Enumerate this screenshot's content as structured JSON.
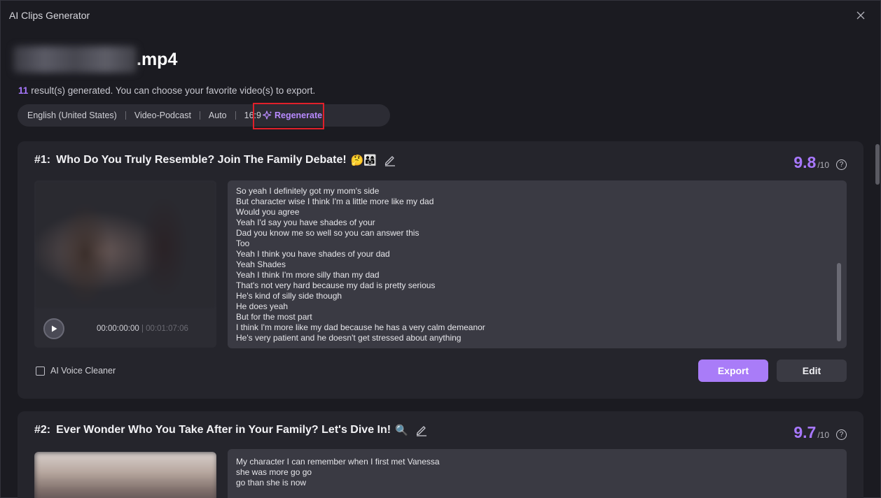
{
  "window": {
    "title": "AI Clips Generator"
  },
  "file": {
    "extension": ".mp4"
  },
  "summary": {
    "count": "11",
    "text": "result(s) generated. You can choose your favorite video(s) to export."
  },
  "settings": {
    "language": "English (United States)",
    "template": "Video-Podcast",
    "length": "Auto",
    "ratio": "16:9",
    "regenerate_label": "Regenerate"
  },
  "clips": [
    {
      "number": "#1:",
      "title": "Who Do You Truly Resemble? Join The Family Debate!",
      "emoji": "🤔👨‍👩‍👧",
      "score": "9.8",
      "score_max": "/10",
      "current_time": "00:00:00:00",
      "duration": "| 00:01:07:06",
      "transcript": [
        "So yeah I definitely got my mom's side",
        "But character wise I think I'm a little more like my dad",
        "Would you agree",
        "Yeah I'd say you have shades of your",
        "Dad you know me so well so you can answer this",
        "Too",
        "Yeah I think you have shades of your dad",
        "Yeah Shades",
        "Yeah I think I'm more silly than my dad",
        "That's not very hard because my dad is pretty serious",
        "He's kind of silly side though",
        "He does yeah",
        "But for the most part",
        "I think I'm more like my dad because he has a very calm demeanor",
        "He's very patient and he doesn't get stressed about anything"
      ],
      "voice_cleaner_label": "AI Voice Cleaner",
      "export_label": "Export",
      "edit_label": "Edit"
    },
    {
      "number": "#2:",
      "title": "Ever Wonder Who You Take After in Your Family? Let's Dive In!",
      "emoji": "🔍",
      "score": "9.7",
      "score_max": "/10",
      "transcript": [
        "My character I can remember when I first met Vanessa",
        "she was more go go",
        "go than she is now"
      ]
    }
  ],
  "colors": {
    "accent": "#a878ff",
    "export_button": "#a97cf8",
    "highlight_box": "#e0202a"
  }
}
